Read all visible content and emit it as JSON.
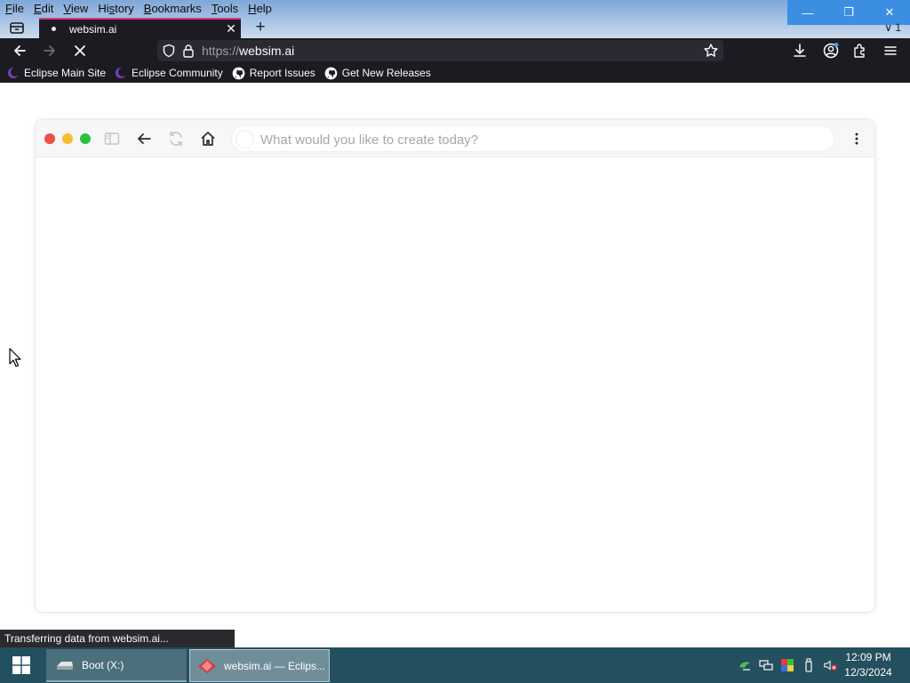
{
  "menu": [
    "File",
    "Edit",
    "View",
    "History",
    "Bookmarks",
    "Tools",
    "Help"
  ],
  "menu_access_keys": [
    "F",
    "E",
    "V",
    "s",
    "B",
    "T",
    "H"
  ],
  "window_controls": {
    "minimize": "—",
    "restore": "❐",
    "close": "✕"
  },
  "tab_overflow": "∨ 1",
  "tab": {
    "title": "websim.ai",
    "close": "✕"
  },
  "new_tab": "+",
  "url": {
    "scheme": "https://",
    "host": "websim.ai"
  },
  "bookmarks": [
    {
      "label": "Eclipse Main Site",
      "icon": "eclipse-icon"
    },
    {
      "label": "Eclipse Community",
      "icon": "eclipse-icon"
    },
    {
      "label": "Report Issues",
      "icon": "github-icon"
    },
    {
      "label": "Get New Releases",
      "icon": "github-icon"
    }
  ],
  "websim": {
    "prompt_placeholder": "What would you like to create today?",
    "traffic_colors": [
      "#ee4f49",
      "#f5bf2d",
      "#27c242"
    ]
  },
  "status_text": "Transferring data from websim.ai...",
  "taskbar": {
    "items": [
      {
        "label": "Boot (X:)",
        "icon": "drive-icon"
      },
      {
        "label": "websim.ai — Eclips...",
        "icon": "browser-icon"
      }
    ],
    "time": "12:09 PM",
    "date": "12/3/2024"
  }
}
